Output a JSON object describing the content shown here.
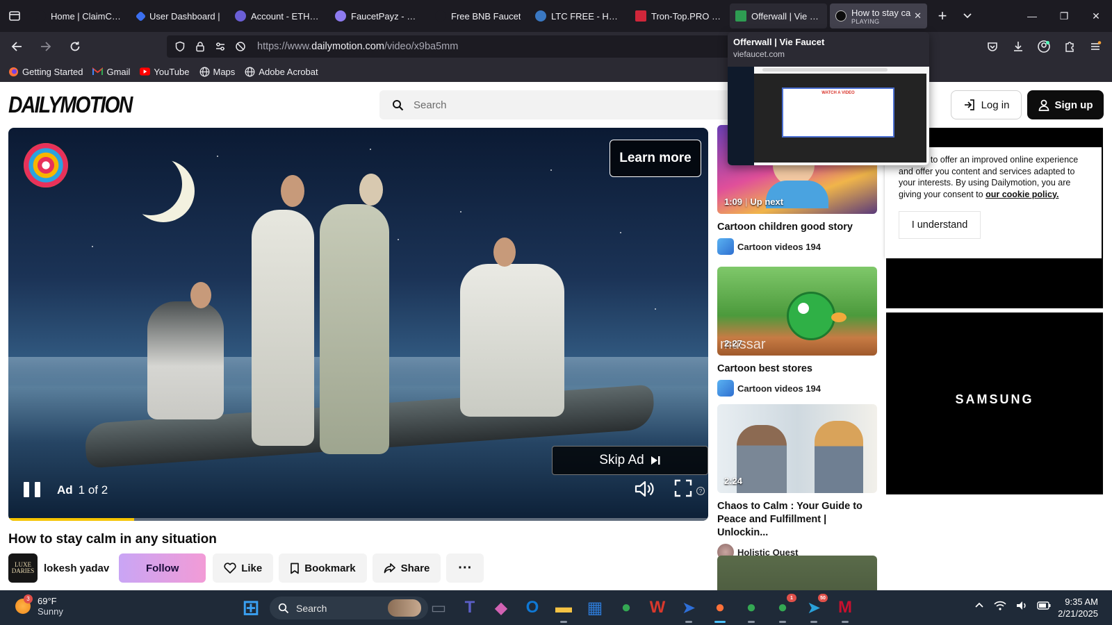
{
  "browser": {
    "tabs": [
      {
        "label": "Home | ClaimCrypto",
        "favicon_color": "#1c1b22"
      },
      {
        "label": "User Dashboard |",
        "favicon_color": "#3b6ff0"
      },
      {
        "label": "Account - ETHMir",
        "favicon_color": "#6b5fd6"
      },
      {
        "label": "FaucetPayz - Hom",
        "favicon_color": "#8e7bf0"
      },
      {
        "label": "Free BNB Faucet",
        "favicon_color": "#1c1b22"
      },
      {
        "label": "LTC FREE - Home",
        "favicon_color": "#3a78c2"
      },
      {
        "label": "Tron-Top.PRO - M",
        "favicon_color": "#d0263a"
      },
      {
        "label": "Offerwall | Vie Fau",
        "favicon_color": "#2e9c52"
      }
    ],
    "active_tab": {
      "label": "How to stay ca",
      "sublabel": "PLAYING"
    },
    "url": {
      "prefix": "https://www.",
      "domain": "dailymotion.com",
      "path": "/video/x9ba5mm"
    },
    "bookmarks": [
      {
        "label": "Getting Started",
        "icon": "firefox-icon",
        "color": "#ff7139"
      },
      {
        "label": "Gmail",
        "icon": "gmail-icon",
        "color": "#ea4335"
      },
      {
        "label": "YouTube",
        "icon": "youtube-icon",
        "color": "#ff0000"
      },
      {
        "label": "Maps",
        "icon": "globe-icon",
        "color": "#e8e8ec"
      },
      {
        "label": "Adobe Acrobat",
        "icon": "globe-icon",
        "color": "#e8e8ec"
      }
    ],
    "tab_preview": {
      "title": "Offerwall | Vie Faucet",
      "domain": "viefaucet.com",
      "modal_title": "WATCH A VIDEO"
    }
  },
  "site": {
    "logo": "DAILYMOTION",
    "search_placeholder": "Search",
    "login_label": "Log in",
    "signup_label": "Sign up"
  },
  "player": {
    "learn_more": "Learn more",
    "skip_ad": "Skip Ad",
    "ad_label": "Ad",
    "ad_count": "1 of 2",
    "progress": 0.18,
    "progress_color": "#f5c400"
  },
  "video": {
    "title": "How to stay calm in any situation",
    "channel": "lokesh yadav",
    "avatar_text": "LUXE DARIES",
    "follow": "Follow",
    "like": "Like",
    "bookmark": "Bookmark",
    "share": "Share",
    "more": "···"
  },
  "sidebar": {
    "cards": [
      {
        "duration": "1:09",
        "upnext": "Up next",
        "title": "Cartoon children good story",
        "channel": "Cartoon videos 194",
        "thumb_text": ""
      },
      {
        "duration": "2:27",
        "upnext": "",
        "title": "Cartoon best stores",
        "channel": "Cartoon videos 194",
        "thumb_text": "mussar"
      },
      {
        "duration": "2:24",
        "upnext": "",
        "title": "Chaos to Calm : Your Guide to Peace and Fulfillment | Unlockin...",
        "channel": "Holistic Quest",
        "thumb_text": ""
      }
    ]
  },
  "cookie": {
    "text": "cookies to offer an improved online experience and offer you content and services adapted to your interests. By using Dailymotion, you are giving your consent to",
    "link": "our cookie policy.",
    "button": "I understand"
  },
  "ads": {
    "brand": "SAMSUNG"
  },
  "taskbar": {
    "weather_badge": "3",
    "temp": "69°F",
    "condition": "Sunny",
    "search": "Search",
    "time": "9:35 AM",
    "date": "2/21/2025",
    "icons": [
      {
        "name": "start-icon",
        "color": "#3aa0f2",
        "badge": ""
      },
      {
        "name": "file-viewer-icon",
        "color": "#6d7684",
        "badge": ""
      },
      {
        "name": "teams-icon",
        "color": "#5b5fc7",
        "badge": ""
      },
      {
        "name": "copilot-icon",
        "color": "#d262b3",
        "badge": ""
      },
      {
        "name": "outlook-icon",
        "color": "#0f78d4",
        "badge": ""
      },
      {
        "name": "file-explorer-icon",
        "color": "#f5c344",
        "badge": ""
      },
      {
        "name": "store-icon",
        "color": "#2d7ad6",
        "badge": ""
      },
      {
        "name": "chrome-icon",
        "color": "#34a853",
        "badge": ""
      },
      {
        "name": "wps-icon",
        "color": "#d8382c",
        "badge": ""
      },
      {
        "name": "bluebird-icon",
        "color": "#2e6fd8",
        "badge": ""
      },
      {
        "name": "firefox-icon",
        "color": "#ff7139",
        "badge": ""
      },
      {
        "name": "chrome-profile-icon",
        "color": "#34a853",
        "badge": ""
      },
      {
        "name": "chrome-profile-2-icon",
        "color": "#34a853",
        "badge": "1"
      },
      {
        "name": "telegram-icon",
        "color": "#2aa1da",
        "badge": "50"
      },
      {
        "name": "mcafee-icon",
        "color": "#c8102e",
        "badge": ""
      }
    ]
  }
}
